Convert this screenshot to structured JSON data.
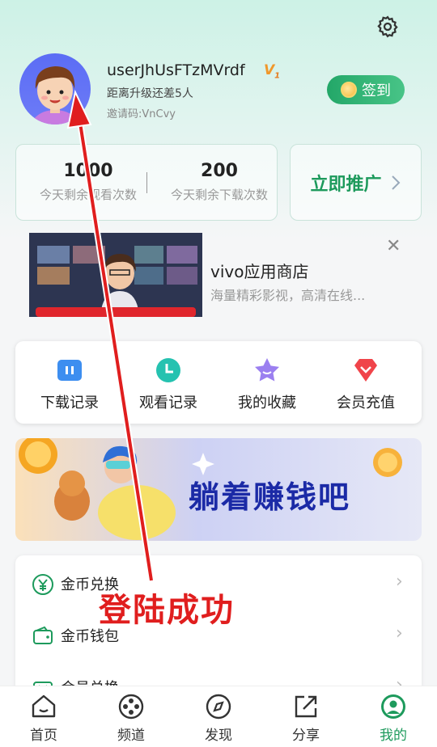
{
  "profile": {
    "username": "userJhUsFTzMVrdf",
    "vip_badge": "V",
    "vip_level": "1",
    "upgrade_text": "距离升级还差5人",
    "invite_code": "邀请码:VnCvy",
    "signin_label": "签到"
  },
  "stats": {
    "watch_count": "1000",
    "watch_label": "今天剩余观看次数",
    "download_count": "200",
    "download_label": "今天剩余下载次数",
    "promote_label": "立即推广"
  },
  "ad": {
    "title": "vivo应用商店",
    "description": "海量精彩影视，高清在线...",
    "close": "✕"
  },
  "quick_actions": [
    {
      "label": "下载记录",
      "icon": "download-record-icon"
    },
    {
      "label": "观看记录",
      "icon": "watch-record-icon"
    },
    {
      "label": "我的收藏",
      "icon": "favorite-star-icon"
    },
    {
      "label": "会员充值",
      "icon": "vip-recharge-icon"
    }
  ],
  "banner": {
    "text": "躺着赚钱吧"
  },
  "menu": [
    {
      "label": "金币兑换",
      "icon": "coin-exchange-icon"
    },
    {
      "label": "金币钱包",
      "icon": "wallet-icon"
    },
    {
      "label": "会员兑换",
      "icon": "vip-exchange-icon"
    }
  ],
  "nav": [
    {
      "label": "首页",
      "icon": "home-icon"
    },
    {
      "label": "频道",
      "icon": "channel-icon"
    },
    {
      "label": "发现",
      "icon": "discover-compass-icon"
    },
    {
      "label": "分享",
      "icon": "share-icon"
    },
    {
      "label": "我的",
      "icon": "profile-icon"
    }
  ],
  "annotation": {
    "text": "登陆成功"
  },
  "colors": {
    "accent": "#1d9a5c",
    "annotation_red": "#e01e1e",
    "vip_orange": "#f0972a"
  }
}
